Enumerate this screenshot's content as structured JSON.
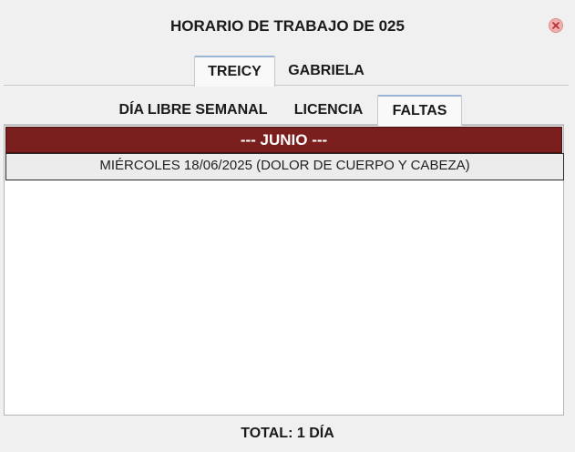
{
  "window": {
    "title": "HORARIO DE TRABAJO DE 025",
    "close_icon": "close-icon"
  },
  "person_tabs": {
    "items": [
      {
        "label": "TREICY",
        "active": true
      },
      {
        "label": "GABRIELA",
        "active": false
      }
    ]
  },
  "category_tabs": {
    "items": [
      {
        "label": "DÍA LIBRE SEMANAL",
        "active": false
      },
      {
        "label": "LICENCIA",
        "active": false
      },
      {
        "label": "FALTAS",
        "active": true
      }
    ]
  },
  "list": {
    "month_header": "--- JUNIO ---",
    "entries": [
      {
        "text": "MIÉRCOLES 18/06/2025 (DOLOR DE CUERPO Y CABEZA)"
      }
    ]
  },
  "footer": {
    "total": "TOTAL: 1 DÍA"
  },
  "colors": {
    "month_header_bg": "#7a1f1e",
    "active_tab_accent": "#9ab4d4",
    "close_button": "#f3b0b0"
  }
}
